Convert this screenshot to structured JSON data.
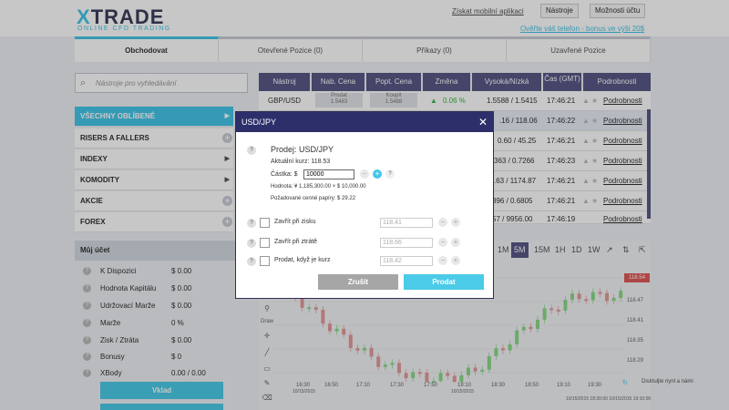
{
  "header": {
    "logo_main": "TRADE",
    "logo_x": "X",
    "logo_sub": "ONLINE CFD TRADING",
    "mobile_link": "Získat mobilní aplikaci",
    "tools_btn": "Nástroje",
    "account_btn": "Možnosti účtu",
    "promo": "Ověřte váš telefon - bonus ve výši 20$"
  },
  "tabs": [
    "Obchodovat",
    "Otevřené Pozice (0)",
    "Příkazy (0)",
    "Uzavřené Pozice"
  ],
  "search": {
    "placeholder": "Nástroje pro vyhledávání"
  },
  "categories": [
    "VŠECHNY OBLÍBENÉ",
    "RISERS A FALLERS",
    "INDEXY",
    "KOMODITY",
    "AKCIE",
    "FOREX"
  ],
  "account": {
    "title": "Můj účet",
    "rows": [
      {
        "label": "K Dispozici",
        "value": "$ 0.00"
      },
      {
        "label": "Hodnota Kapitálu",
        "value": "$ 0.00"
      },
      {
        "label": "Udržovací Marže",
        "value": "$ 0.00"
      },
      {
        "label": "Marže",
        "value": "0 %"
      },
      {
        "label": "Zisk / Ztráta",
        "value": "$ 0.00"
      },
      {
        "label": "Bonusy",
        "value": "$ 0"
      },
      {
        "label": "XBody",
        "value": "0.00 / 0.00"
      }
    ],
    "deposit_btn": "Vklad"
  },
  "table": {
    "headers": [
      "Nástroj",
      "Nab. Cena",
      "Popt. Cena",
      "Změna",
      "Vysoká/Nízká",
      "Čas (GMT)",
      "Podrobnosti"
    ],
    "sell_label": "Prodat",
    "buy_label": "Koupit",
    "rows": [
      {
        "name": "GBP/USD",
        "sell": "1.5483",
        "buy": "1.5488",
        "change": "0.06 %",
        "hl": "1.5588 / 1.5415",
        "time": "17:46:21",
        "details": "Podrobnosti"
      },
      {
        "hl": ".16 / 118.06",
        "time": "17:46:22",
        "details": "Podrobnosti"
      },
      {
        "hl": "0.60 / 45.25",
        "time": "17:46:21",
        "details": "Podrobnosti"
      },
      {
        "hl": "363 / 0.7266",
        "time": "17:46:23",
        "details": "Podrobnosti"
      },
      {
        "hl": ".63 / 1174.87",
        "time": "17:46:21",
        "details": "Podrobnosti"
      },
      {
        "hl": "396 / 0.6805",
        "time": "17:46:21",
        "details": "Podrobnosti"
      },
      {
        "hl": "57 / 9956.00",
        "time": "17:46:19",
        "details": "Podrobnosti"
      }
    ]
  },
  "chart": {
    "timeframes": [
      "1M",
      "5M",
      "15M",
      "1H",
      "1D",
      "1W"
    ],
    "active_tf": "5M",
    "draw_label": "Draw",
    "price_tag": "118.54",
    "y_labels": [
      "118.47",
      "118.41",
      "118.35",
      "118.29"
    ],
    "x_labels": [
      "16:30",
      "16:50",
      "17:10",
      "17:30",
      "17:50",
      "18:10",
      "18:30",
      "18:50",
      "19:10",
      "19:30"
    ],
    "date_left": "10/15/2015",
    "date_mid": "10/15/2015",
    "date_stamps": "10/15/2015 18:30:00  10/15/2015 19:10:00",
    "disconnect": "Disktuljte nynl a námi"
  },
  "modal": {
    "title": "USD/JPY",
    "heading": "Prodej: USD/JPY",
    "rate": "Aktuální kurz: 118.53",
    "amount_label": "Částka: $",
    "amount": "10000",
    "value": "Hodnota: ¥ 1,185,300.00 × $ 10,000.00",
    "securities": "Požadované cenné papíry: $ 29.22",
    "take_profit": "Zavřít při zisku",
    "take_profit_val": "118.41",
    "stop_loss": "Zavřít při ztrátě",
    "stop_loss_val": "118.66",
    "limit": "Prodat, když je kurz",
    "limit_val": "118.42",
    "cancel": "Zrušit",
    "submit": "Prodat"
  },
  "colors": {
    "accent": "#45c6e8",
    "header_dark": "#585986",
    "modal_head": "#2d2f6b",
    "bull": "#8ad98a",
    "bear": "#e59a9a"
  }
}
